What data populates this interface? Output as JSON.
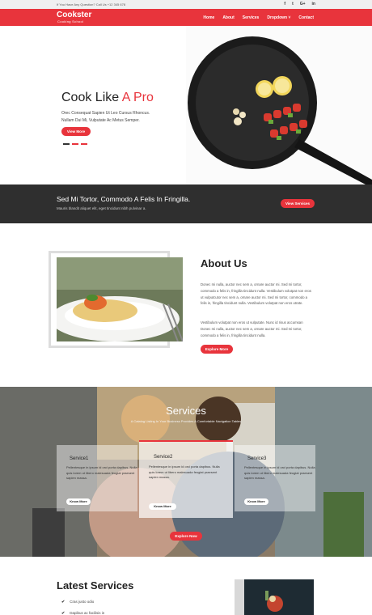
{
  "topbar": {
    "contact_text": "If You Have Any Question? Call Us +12 345 678",
    "social": [
      {
        "icon": "facebook-icon",
        "glyph": "f"
      },
      {
        "icon": "twitter-icon",
        "glyph": "t"
      },
      {
        "icon": "google-plus-icon",
        "glyph": "G+"
      },
      {
        "icon": "linkedin-icon",
        "glyph": "in"
      }
    ]
  },
  "nav": {
    "logo": "Cookster",
    "logo_sub": "Cooking School",
    "items": [
      "Home",
      "About",
      "Services",
      "Dropdown ˅",
      "Contact"
    ]
  },
  "hero": {
    "title_main": "Cook Like ",
    "title_accent": "A Pro",
    "text_line1": "Orec Consequat Sapien Ut Leo Cursus Rhoncus.",
    "text_line2": "Nullam Dui Mi, Vulputate Ac Metus Semper.",
    "button": "View More"
  },
  "banner": {
    "title": "Sed Mi Tortor, Commodo A Felis In Fringilla.",
    "text": "Mauris blandit aliquet elit, eget tincidunt nibh pulvinar a.",
    "button": "View Services"
  },
  "about": {
    "title": "About Us",
    "para1": "Donec mi nulla, auctor nec sem a, ornare auctor mi. Sed mi tortor, commodo a felis in, fringilla tincidunt nulla. Vestibulum volutpat non eros ut vulputcutor nec sem a, ornare auctor mi. Sed mi tortor, commodo a felis in, fringilla tincidunt nulla. Vestibulum volutpat non eros utrate.",
    "para2": "Vestibulum volutpat non eros ut vulputate. Nunc id risus accumsan Donec mi nulla, auctor nec sem a, ornare auctor mi. Sed mi tortor, commodo a felis in, fringilla tincidunt nulla.",
    "button": "Explore More"
  },
  "services": {
    "title": "Services",
    "subtitle": "A Catalog Listing In Your Business Provides A Comfortable Navigation Tables",
    "cards": [
      {
        "title": "Service1",
        "text": "Pellentesque in ipsum id orci porta dapibus. Nulla quis lorem ut libero malesuada feugiat praesent sapien massa.",
        "button": "Know More"
      },
      {
        "title": "Service2",
        "text": "Pellentesque in ipsum id orci porta dapibus. Nulla quis lorem ut libero malesuada feugiat praesent sapien massa.",
        "button": "Know More"
      },
      {
        "title": "Service3",
        "text": "Pellentesque in ipsum id orci porta dapibus. Nulla quis lorem ut libero malesuada feugiat praesent sapien massa.",
        "button": "Know More"
      }
    ],
    "button": "Explore Now"
  },
  "latest": {
    "title": "Latest Services",
    "items": [
      "Cras justo odio",
      "Dapibus ac facilisis in"
    ]
  },
  "colors": {
    "accent": "#e8343c",
    "dark_band": "#2f2f2f"
  }
}
